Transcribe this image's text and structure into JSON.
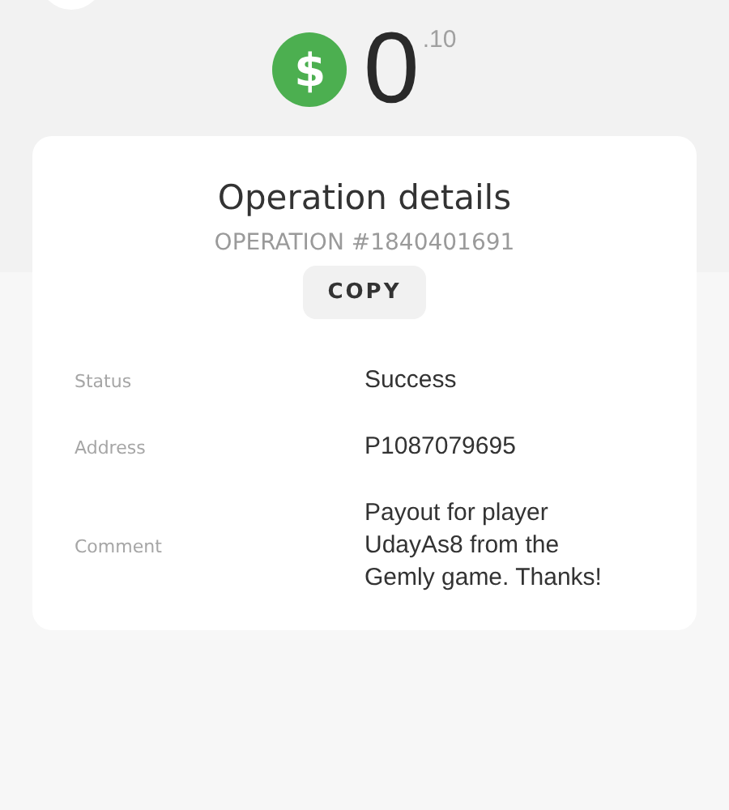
{
  "balance": {
    "currency_symbol": "$",
    "integer": "0",
    "fraction": ".10"
  },
  "details": {
    "title": "Operation details",
    "operation_id": "OPERATION #1840401691",
    "copy_button": "COPY",
    "rows": [
      {
        "label": "Status",
        "value": "Success"
      },
      {
        "label": "Address",
        "value": "P1087079695"
      },
      {
        "label": "Comment",
        "value": "Payout for player UdayAs8 from the Gemly game. Thanks!"
      }
    ]
  }
}
